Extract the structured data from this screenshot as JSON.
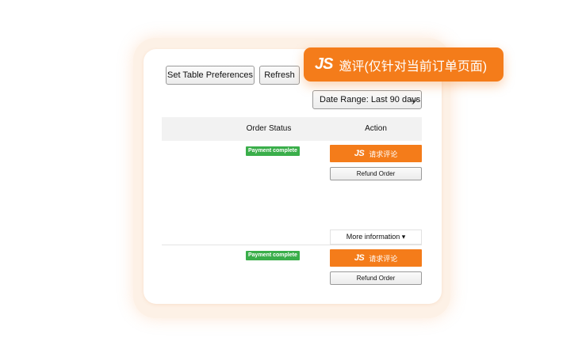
{
  "toolbar": {
    "set_table_preferences_label": "Set Table Preferences",
    "refresh_label": "Refresh",
    "date_range_label": "Date Range: Last 90 days"
  },
  "tooltip": {
    "logo": "JS",
    "text": "邀评(仅针对当前订单页面)",
    "color": "#f47c1a"
  },
  "table": {
    "columns": [
      "Order Status",
      "Action"
    ],
    "more_information_label": "More information ▾",
    "rows": [
      {
        "status": "Payment complete",
        "review_logo": "JS",
        "review_label": "请求评论",
        "refund_label": "Refund Order"
      },
      {
        "status": "Payment complete",
        "review_logo": "JS",
        "review_label": "请求评论",
        "refund_label": "Refund Order"
      }
    ]
  },
  "colors": {
    "accent": "#f47c1a",
    "status_green": "#3aae4a"
  }
}
